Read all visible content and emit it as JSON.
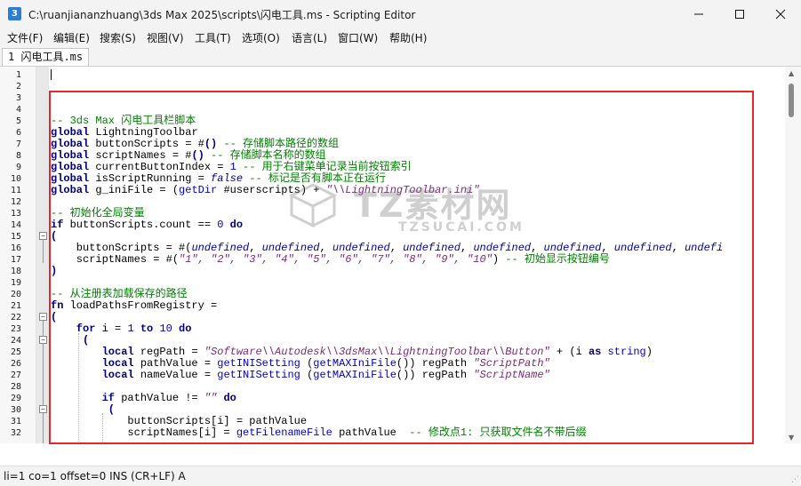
{
  "window": {
    "title": "C:\\ruanjiananzhuang\\3ds Max 2025\\scripts\\闪电工具.ms - Scripting Editor",
    "app_icon": "3"
  },
  "menu": [
    "文件(F)",
    "编辑(E)",
    "搜索(S)",
    "视图(V)",
    "工具(T)",
    "选项(O)",
    "语言(L)",
    "窗口(W)",
    "帮助(H)"
  ],
  "tab": {
    "label": "1 闪电工具.ms"
  },
  "line_numbers": [
    "1",
    "2",
    "3",
    "4",
    "5",
    "6",
    "7",
    "8",
    "9",
    "10",
    "11",
    "12",
    "13",
    "14",
    "15",
    "16",
    "17",
    "18",
    "19",
    "20",
    "21",
    "22",
    "23",
    "24",
    "25",
    "26",
    "27",
    "28",
    "29",
    "30",
    "31",
    "32"
  ],
  "code": {
    "l5_comment": "-- 3ds Max 闪电工具栏脚本",
    "l6": {
      "kw": "global",
      "text": " LightningToolbar"
    },
    "l7": {
      "kw": "global",
      "text": " buttonScripts = #",
      "paren": "()",
      "comment": " -- 存储脚本路径的数组"
    },
    "l8": {
      "kw": "global",
      "text": " scriptNames = #",
      "paren": "()",
      "comment": " -- 存储脚本名称的数组"
    },
    "l9": {
      "kw": "global",
      "text": " currentButtonIndex = ",
      "num": "1",
      "comment": " -- 用于右键菜单记录当前按钮索引"
    },
    "l10": {
      "kw": "global",
      "text": " isScriptRunning = ",
      "val": "false",
      "comment": " -- 标记是否有脚本正在运行"
    },
    "l11": {
      "kw": "global",
      "text": " g_iniFile = (",
      "fn": "getDir",
      "text2": " #userscripts) + ",
      "str": "\"\\\\LightningToolbar.ini\""
    },
    "l13_comment": "-- 初始化全局变量",
    "l14": {
      "kw": "if",
      "text": " buttonScripts.count == ",
      "num": "0",
      "kw2": " do"
    },
    "l15": "(",
    "l16": {
      "text": "    buttonScripts = #(",
      "items": [
        "undefined",
        "undefined",
        "undefined",
        "undefined",
        "undefined",
        "undefined",
        "undefined",
        "undefi"
      ]
    },
    "l17": {
      "text": "    scriptNames = #(",
      "strs": "\"1\", \"2\", \"3\", \"4\", \"5\", \"6\", \"7\", \"8\", \"9\", \"10\"",
      "close": ")",
      "comment": " -- 初始显示按钮编号"
    },
    "l18": ")",
    "l20_comment": "-- 从注册表加载保存的路径",
    "l21": {
      "kw": "fn",
      "text": " loadPathsFromRegistry ="
    },
    "l22": "(",
    "l23": {
      "kw": "    for",
      "text": " i = ",
      "num1": "1",
      "kw2": " to ",
      "num2": "10",
      "kw3": " do"
    },
    "l24": "     (",
    "l25": {
      "kw": "        local",
      "text": " regPath = ",
      "str": "\"Software\\\\Autodesk\\\\3dsMax\\\\LightningToolbar\\\\Button\"",
      "text2": " + (i ",
      "kw2": "as",
      "fn": " string",
      "close": ")"
    },
    "l26": {
      "kw": "        local",
      "text": " pathValue = ",
      "fn": "getINISetting",
      "text2": " (",
      "fn2": "getMAXIniFile",
      "text3": "()) regPath ",
      "str": "\"ScriptPath\""
    },
    "l27": {
      "kw": "        local",
      "text": " nameValue = ",
      "fn": "getINISetting",
      "text2": " (",
      "fn2": "getMAXIniFile",
      "text3": "()) regPath ",
      "str": "\"ScriptName\""
    },
    "l29": {
      "kw": "        if",
      "text": " pathValue != ",
      "str": "\"\"",
      "kw2": " do"
    },
    "l30": "         (",
    "l31": {
      "text": "            buttonScripts[i] = pathValue"
    },
    "l32": {
      "text": "            scriptNames[i] = ",
      "fn": "getFilenameFile",
      "text2": " pathValue  ",
      "comment": "-- 修改点1: 只获取文件名不带后缀"
    }
  },
  "watermark": {
    "big": "TZ素材网",
    "small": "TZSUCAI.COM"
  },
  "status": {
    "text": "li=1 co=1 offset=0 INS (CR+LF) A"
  },
  "colors": {
    "highlight_border": "#e8262a",
    "keyword": "#00007a",
    "comment": "#008000",
    "string": "#7a2a7a",
    "number": "#0000c8"
  }
}
